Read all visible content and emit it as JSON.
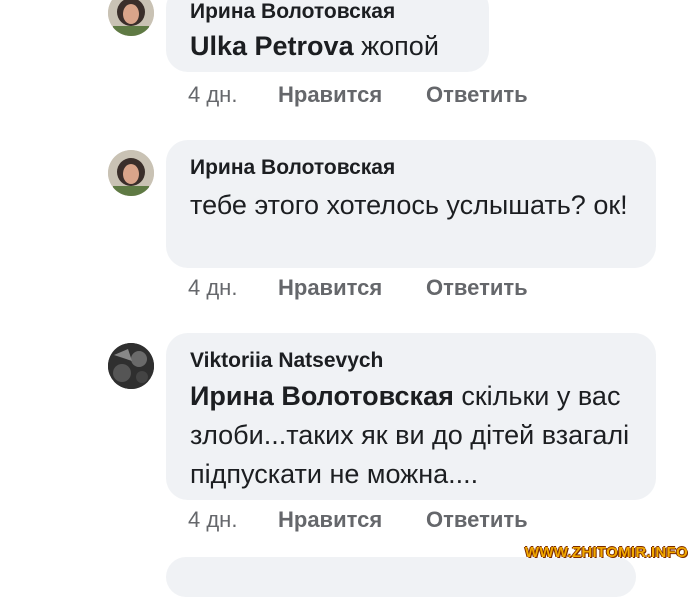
{
  "comments": [
    {
      "author": "Ирина Волотовская",
      "mention": "Ulka Petrova",
      "text": "жопой",
      "time": "4 дн.",
      "like_label": "Нравится",
      "reply_label": "Ответить"
    },
    {
      "author": "Ирина Волотовская",
      "mention": "",
      "text": "тебе этого хотелось услышать? ок!",
      "time": "4 дн.",
      "like_label": "Нравится",
      "reply_label": "Ответить"
    },
    {
      "author": "Viktoriia Natsevych",
      "mention": "Ирина Волотовская",
      "text": "скільки у вас злоби...таких як ви до дітей взагалі підпускати не можна....",
      "time": "4 дн.",
      "like_label": "Нравится",
      "reply_label": "Ответить"
    }
  ],
  "watermark": "WWW.ZHITOMIR.INFO",
  "colors": {
    "bubble": "#f0f2f5",
    "meta_text": "#65676b",
    "body_text": "#1c1e21",
    "watermark": "#f2a900"
  }
}
